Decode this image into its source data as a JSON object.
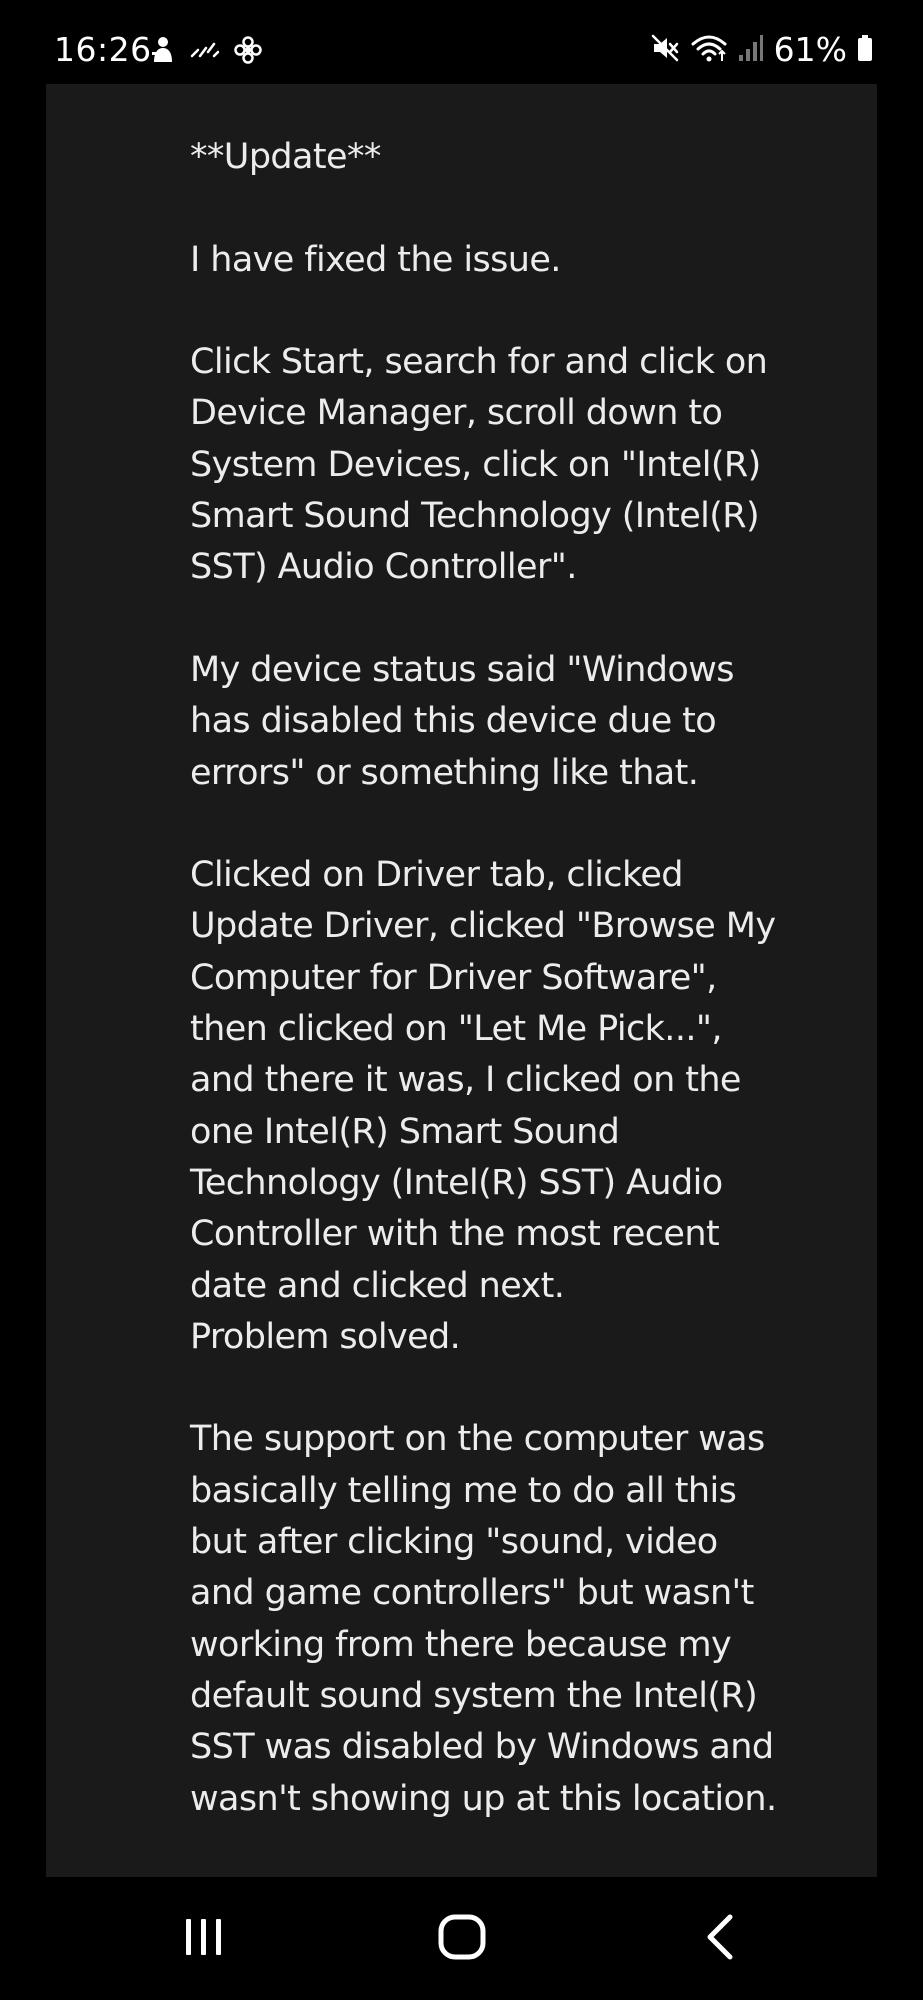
{
  "status_bar": {
    "time": "16:26",
    "battery": "61%",
    "left_icons": [
      "person-icon",
      "signal-dots-icon",
      "fan-icon"
    ],
    "right_icons": [
      "mute-icon",
      "wifi-icon",
      "cell-signal-icon",
      "battery-icon"
    ]
  },
  "post": {
    "text": "**Update**\n\nI have fixed the issue.\n\nClick Start, search for and click on Device Manager, scroll down to System Devices, click on \"Intel(R) Smart Sound Technology (Intel(R) SST) Audio Controller\".\n\nMy device status said \"Windows has disabled this device due to errors\" or something like that.\n\nClicked on Driver tab, clicked Update Driver, clicked \"Browse My Computer for Driver Software\", then clicked on \"Let Me Pick...\", and there it was, I clicked on the one Intel(R) Smart Sound Technology (Intel(R) SST) Audio Controller with the most recent date and clicked next.\nProblem solved.\n\nThe support on the computer was basically telling me to do all this but after clicking \"sound, video and game controllers\" but wasn't working from there because my default sound system the Intel(R) SST was disabled by Windows and wasn't showing up at this location."
  },
  "nav_bar": {
    "buttons": [
      "recents-icon",
      "home-icon",
      "back-icon"
    ]
  },
  "colors": {
    "background": "#000000",
    "panel": "#1a1a1a",
    "text": "#ececec"
  }
}
